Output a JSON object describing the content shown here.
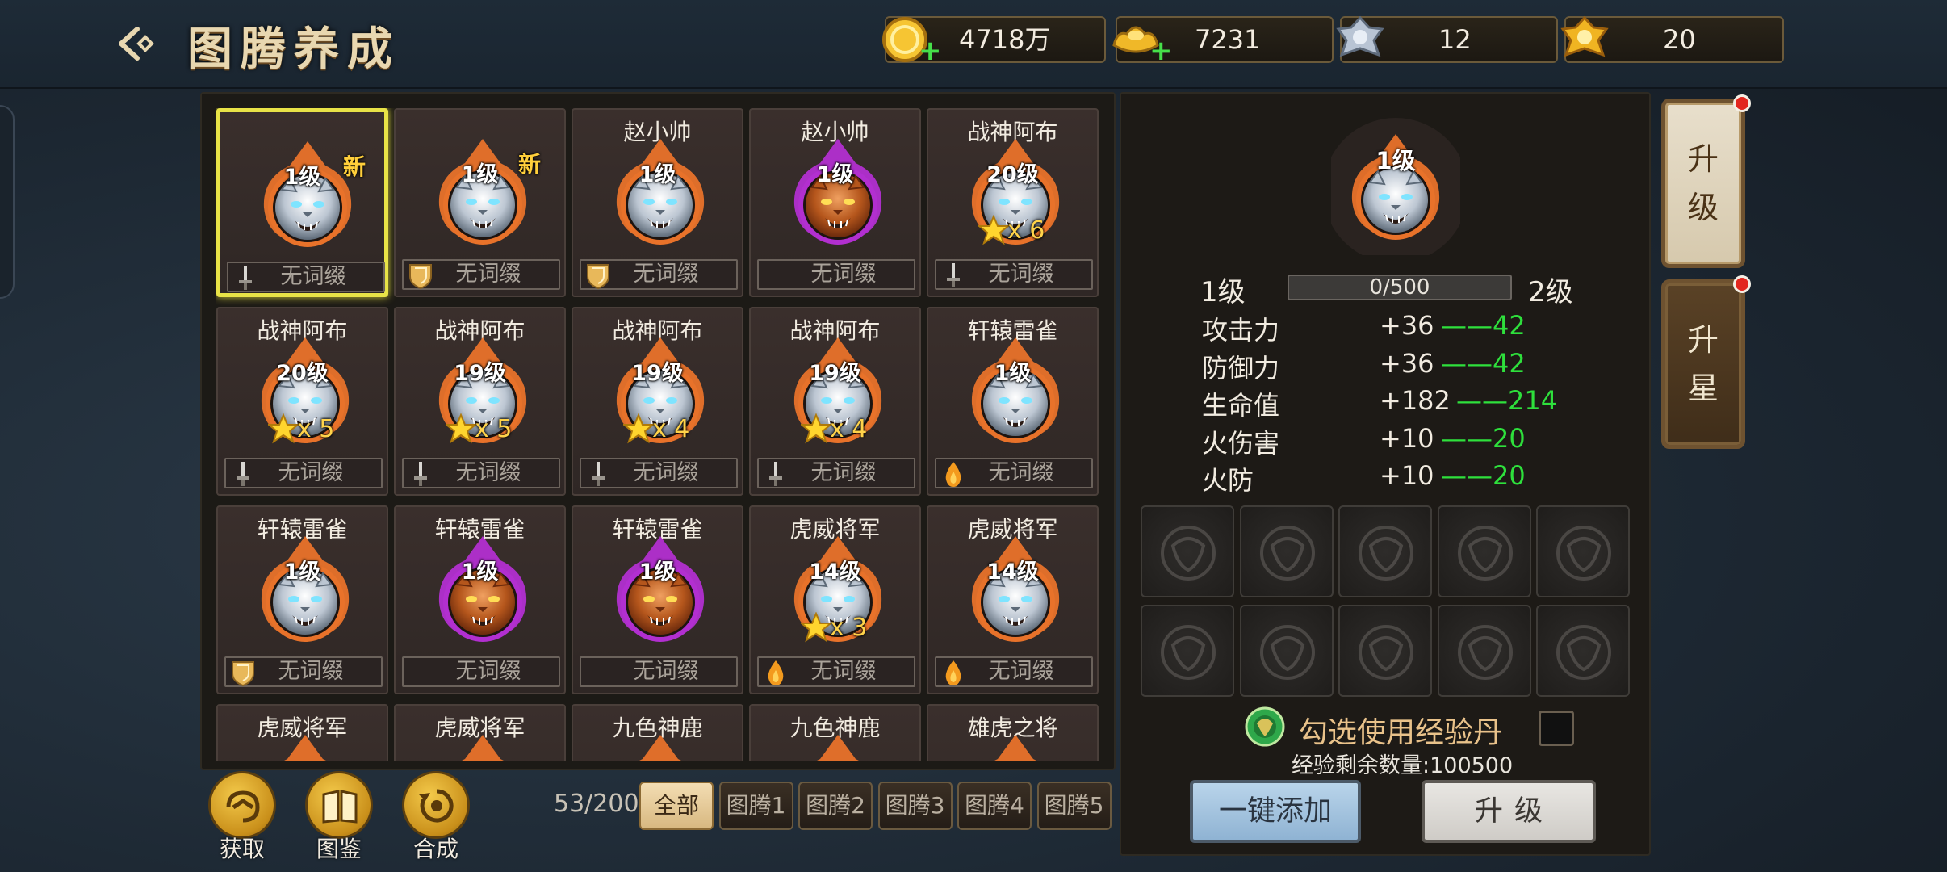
{
  "header": {
    "title": "图腾养成"
  },
  "resources": [
    {
      "icon": "gold-coin-icon",
      "value": "4718万",
      "has_plus": true
    },
    {
      "icon": "gold-ingot-icon",
      "value": "7231",
      "has_plus": true
    },
    {
      "icon": "silver-badge-icon",
      "value": "12",
      "has_plus": false
    },
    {
      "icon": "gold-badge-icon",
      "value": "20",
      "has_plus": false
    }
  ],
  "grid": {
    "items": [
      {
        "name": "",
        "level": "1级",
        "is_new": true,
        "new_label": "新",
        "stars": "",
        "border": "orange",
        "beast": "silver",
        "affix": "无词缀",
        "affix_icon": "sword",
        "selected": true
      },
      {
        "name": "",
        "level": "1级",
        "is_new": true,
        "new_label": "新",
        "stars": "",
        "border": "orange",
        "beast": "silver",
        "affix": "无词缀",
        "affix_icon": "shield",
        "selected": false
      },
      {
        "name": "赵小帅",
        "level": "1级",
        "is_new": false,
        "stars": "",
        "border": "orange",
        "beast": "silver",
        "affix": "无词缀",
        "affix_icon": "shield",
        "selected": false
      },
      {
        "name": "赵小帅",
        "level": "1级",
        "is_new": false,
        "stars": "",
        "border": "purple",
        "beast": "bronze",
        "affix": "无词缀",
        "affix_icon": "",
        "selected": false
      },
      {
        "name": "战神阿布",
        "level": "20级",
        "is_new": false,
        "stars": "x 6",
        "border": "orange",
        "beast": "silver",
        "affix": "无词缀",
        "affix_icon": "sword",
        "selected": false
      },
      {
        "name": "战神阿布",
        "level": "20级",
        "is_new": false,
        "stars": "x 5",
        "border": "orange",
        "beast": "silver",
        "affix": "无词缀",
        "affix_icon": "sword",
        "selected": false
      },
      {
        "name": "战神阿布",
        "level": "19级",
        "is_new": false,
        "stars": "x 5",
        "border": "orange",
        "beast": "silver",
        "affix": "无词缀",
        "affix_icon": "sword",
        "selected": false
      },
      {
        "name": "战神阿布",
        "level": "19级",
        "is_new": false,
        "stars": "x 4",
        "border": "orange",
        "beast": "silver",
        "affix": "无词缀",
        "affix_icon": "sword",
        "selected": false
      },
      {
        "name": "战神阿布",
        "level": "19级",
        "is_new": false,
        "stars": "x 4",
        "border": "orange",
        "beast": "silver",
        "affix": "无词缀",
        "affix_icon": "sword",
        "selected": false
      },
      {
        "name": "轩辕雷雀",
        "level": "1级",
        "is_new": false,
        "stars": "",
        "border": "orange",
        "beast": "silver",
        "affix": "无词缀",
        "affix_icon": "flame",
        "selected": false
      },
      {
        "name": "轩辕雷雀",
        "level": "1级",
        "is_new": false,
        "stars": "",
        "border": "orange",
        "beast": "silver",
        "affix": "无词缀",
        "affix_icon": "shield",
        "selected": false
      },
      {
        "name": "轩辕雷雀",
        "level": "1级",
        "is_new": false,
        "stars": "",
        "border": "purple",
        "beast": "bronze",
        "affix": "无词缀",
        "affix_icon": "",
        "selected": false
      },
      {
        "name": "轩辕雷雀",
        "level": "1级",
        "is_new": false,
        "stars": "",
        "border": "purple",
        "beast": "bronze",
        "affix": "无词缀",
        "affix_icon": "",
        "selected": false
      },
      {
        "name": "虎威将军",
        "level": "14级",
        "is_new": false,
        "stars": "x 3",
        "border": "orange",
        "beast": "silver",
        "affix": "无词缀",
        "affix_icon": "flame",
        "selected": false
      },
      {
        "name": "虎威将军",
        "level": "14级",
        "is_new": false,
        "stars": "",
        "border": "orange",
        "beast": "silver",
        "affix": "无词缀",
        "affix_icon": "flame",
        "selected": false
      },
      {
        "name": "虎威将军",
        "level": "",
        "is_new": false,
        "stars": "",
        "border": "orange",
        "beast": "silver",
        "affix": "",
        "affix_icon": "",
        "selected": false
      },
      {
        "name": "虎威将军",
        "level": "",
        "is_new": false,
        "stars": "",
        "border": "orange",
        "beast": "silver",
        "affix": "",
        "affix_icon": "",
        "selected": false
      },
      {
        "name": "九色神鹿",
        "level": "",
        "is_new": false,
        "stars": "",
        "border": "orange",
        "beast": "silver",
        "affix": "",
        "affix_icon": "",
        "selected": false
      },
      {
        "name": "九色神鹿",
        "level": "",
        "is_new": false,
        "stars": "",
        "border": "orange",
        "beast": "silver",
        "affix": "",
        "affix_icon": "",
        "selected": false
      },
      {
        "name": "雄虎之将",
        "level": "",
        "is_new": false,
        "stars": "",
        "border": "orange",
        "beast": "silver",
        "affix": "",
        "affix_icon": "",
        "selected": false
      }
    ]
  },
  "bottom": {
    "buttons": [
      {
        "label": "获取",
        "icon": "acquire-icon"
      },
      {
        "label": "图鉴",
        "icon": "codex-icon"
      },
      {
        "label": "合成",
        "icon": "synthesis-icon"
      }
    ],
    "count": "53/200",
    "tabs": [
      "全部",
      "图腾1",
      "图腾2",
      "图腾3",
      "图腾4",
      "图腾5"
    ],
    "active_tab": 0
  },
  "detail": {
    "level": "1级",
    "current_level": "1级",
    "next_level": "2级",
    "xp_text": "0/500",
    "xp_fraction": 0,
    "stats": [
      {
        "name": "攻击力",
        "current": "+36",
        "next": "——42"
      },
      {
        "name": "防御力",
        "current": "+36",
        "next": "——42"
      },
      {
        "name": "生命值",
        "current": "+182",
        "next": "——214"
      },
      {
        "name": "火伤害",
        "current": "+10",
        "next": "——20"
      },
      {
        "name": "火防",
        "current": "+10",
        "next": "——20"
      }
    ],
    "slot_count": 10,
    "exp_pill_label": "勾选使用经验丹",
    "exp_remaining": "经验剩余数量:100500",
    "add_all_button": "一键添加",
    "upgrade_button": "升级"
  },
  "side_tabs": [
    {
      "label": "升级",
      "active": true,
      "has_dot": true
    },
    {
      "label": "升星",
      "active": false,
      "has_dot": true
    }
  ],
  "colors": {
    "accent_green": "#2ee03c",
    "selected_border": "#e8e347",
    "orange_frame": "#e8722a",
    "purple_frame": "#b22fd0"
  }
}
